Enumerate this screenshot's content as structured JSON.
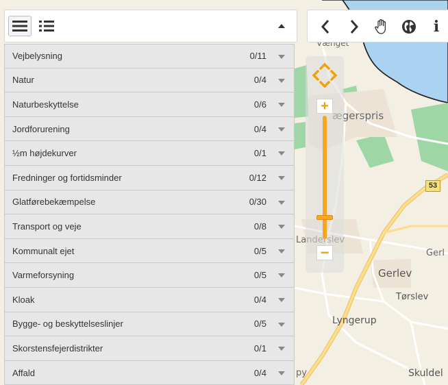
{
  "map": {
    "labels": {
      "vaenget": "Vænget",
      "jerspris": "ægerspris",
      "landerslev": "Landerslev",
      "gerl": "Gerl",
      "gerlev": "Gerlev",
      "torslev": "Tørslev",
      "lyngerup": "Lyngerup",
      "skuldel": "Skuldel",
      "py": "py"
    },
    "road_number": "53",
    "colors": {
      "land": "#f3efe3",
      "water": "#aad3f2",
      "forest": "#9fd6a6",
      "road_major": "#fddc8c",
      "road_minor": "#ffffff"
    }
  },
  "layer_panel": {
    "views": [
      {
        "icon": "list-view-icon",
        "active": true
      },
      {
        "icon": "detail-list-view-icon",
        "active": false
      }
    ],
    "collapse_icon": "caret-up-icon",
    "layers": [
      {
        "name": "Vejbelysning",
        "count": "0/11"
      },
      {
        "name": "Natur",
        "count": "0/4"
      },
      {
        "name": "Naturbeskyttelse",
        "count": "0/6"
      },
      {
        "name": "Jordforurening",
        "count": "0/4"
      },
      {
        "name": "½m højdekurver",
        "count": "0/1"
      },
      {
        "name": "Fredninger og fortidsminder",
        "count": "0/12"
      },
      {
        "name": "Glatførebekæmpelse",
        "count": "0/30"
      },
      {
        "name": "Transport og veje",
        "count": "0/8"
      },
      {
        "name": "Kommunalt ejet",
        "count": "0/5"
      },
      {
        "name": "Varmeforsyning",
        "count": "0/5"
      },
      {
        "name": "Kloak",
        "count": "0/4"
      },
      {
        "name": "Bygge- og beskyttelseslinjer",
        "count": "0/5"
      },
      {
        "name": "Skorstensfejerdistrikter",
        "count": "0/1"
      },
      {
        "name": "Affald",
        "count": "0/4"
      }
    ]
  },
  "nav_toolbar": {
    "buttons": [
      "back-icon",
      "forward-icon",
      "pan-hand-icon",
      "globe-icon",
      "info-icon"
    ],
    "info_label": "i"
  },
  "zoom": {
    "in_label": "+",
    "out_label": "−",
    "level_fraction": 0.17,
    "accent": "#f5a623"
  }
}
